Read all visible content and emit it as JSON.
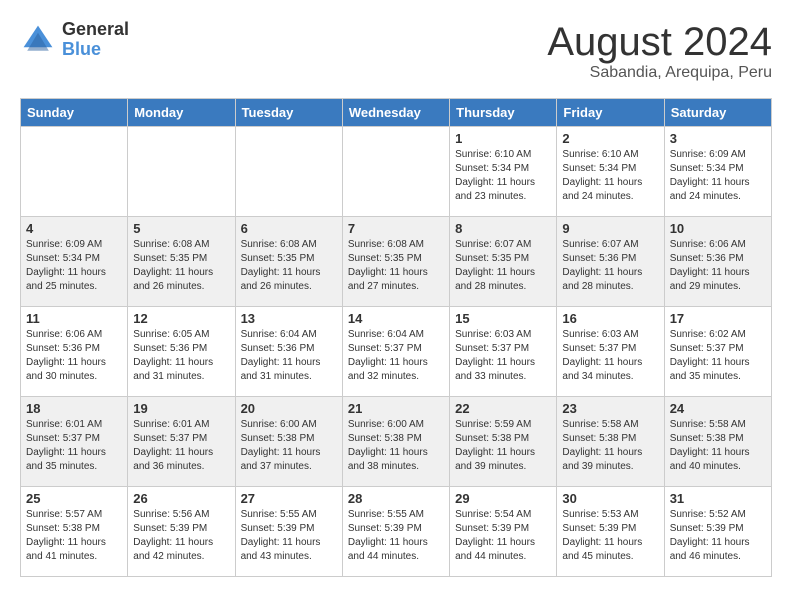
{
  "header": {
    "logo_general": "General",
    "logo_blue": "Blue",
    "title": "August 2024",
    "subtitle": "Sabandia, Arequipa, Peru"
  },
  "days_of_week": [
    "Sunday",
    "Monday",
    "Tuesday",
    "Wednesday",
    "Thursday",
    "Friday",
    "Saturday"
  ],
  "weeks": [
    [
      {
        "day": "",
        "info": ""
      },
      {
        "day": "",
        "info": ""
      },
      {
        "day": "",
        "info": ""
      },
      {
        "day": "",
        "info": ""
      },
      {
        "day": "1",
        "info": "Sunrise: 6:10 AM\nSunset: 5:34 PM\nDaylight: 11 hours\nand 23 minutes."
      },
      {
        "day": "2",
        "info": "Sunrise: 6:10 AM\nSunset: 5:34 PM\nDaylight: 11 hours\nand 24 minutes."
      },
      {
        "day": "3",
        "info": "Sunrise: 6:09 AM\nSunset: 5:34 PM\nDaylight: 11 hours\nand 24 minutes."
      }
    ],
    [
      {
        "day": "4",
        "info": "Sunrise: 6:09 AM\nSunset: 5:34 PM\nDaylight: 11 hours\nand 25 minutes."
      },
      {
        "day": "5",
        "info": "Sunrise: 6:08 AM\nSunset: 5:35 PM\nDaylight: 11 hours\nand 26 minutes."
      },
      {
        "day": "6",
        "info": "Sunrise: 6:08 AM\nSunset: 5:35 PM\nDaylight: 11 hours\nand 26 minutes."
      },
      {
        "day": "7",
        "info": "Sunrise: 6:08 AM\nSunset: 5:35 PM\nDaylight: 11 hours\nand 27 minutes."
      },
      {
        "day": "8",
        "info": "Sunrise: 6:07 AM\nSunset: 5:35 PM\nDaylight: 11 hours\nand 28 minutes."
      },
      {
        "day": "9",
        "info": "Sunrise: 6:07 AM\nSunset: 5:36 PM\nDaylight: 11 hours\nand 28 minutes."
      },
      {
        "day": "10",
        "info": "Sunrise: 6:06 AM\nSunset: 5:36 PM\nDaylight: 11 hours\nand 29 minutes."
      }
    ],
    [
      {
        "day": "11",
        "info": "Sunrise: 6:06 AM\nSunset: 5:36 PM\nDaylight: 11 hours\nand 30 minutes."
      },
      {
        "day": "12",
        "info": "Sunrise: 6:05 AM\nSunset: 5:36 PM\nDaylight: 11 hours\nand 31 minutes."
      },
      {
        "day": "13",
        "info": "Sunrise: 6:04 AM\nSunset: 5:36 PM\nDaylight: 11 hours\nand 31 minutes."
      },
      {
        "day": "14",
        "info": "Sunrise: 6:04 AM\nSunset: 5:37 PM\nDaylight: 11 hours\nand 32 minutes."
      },
      {
        "day": "15",
        "info": "Sunrise: 6:03 AM\nSunset: 5:37 PM\nDaylight: 11 hours\nand 33 minutes."
      },
      {
        "day": "16",
        "info": "Sunrise: 6:03 AM\nSunset: 5:37 PM\nDaylight: 11 hours\nand 34 minutes."
      },
      {
        "day": "17",
        "info": "Sunrise: 6:02 AM\nSunset: 5:37 PM\nDaylight: 11 hours\nand 35 minutes."
      }
    ],
    [
      {
        "day": "18",
        "info": "Sunrise: 6:01 AM\nSunset: 5:37 PM\nDaylight: 11 hours\nand 35 minutes."
      },
      {
        "day": "19",
        "info": "Sunrise: 6:01 AM\nSunset: 5:37 PM\nDaylight: 11 hours\nand 36 minutes."
      },
      {
        "day": "20",
        "info": "Sunrise: 6:00 AM\nSunset: 5:38 PM\nDaylight: 11 hours\nand 37 minutes."
      },
      {
        "day": "21",
        "info": "Sunrise: 6:00 AM\nSunset: 5:38 PM\nDaylight: 11 hours\nand 38 minutes."
      },
      {
        "day": "22",
        "info": "Sunrise: 5:59 AM\nSunset: 5:38 PM\nDaylight: 11 hours\nand 39 minutes."
      },
      {
        "day": "23",
        "info": "Sunrise: 5:58 AM\nSunset: 5:38 PM\nDaylight: 11 hours\nand 39 minutes."
      },
      {
        "day": "24",
        "info": "Sunrise: 5:58 AM\nSunset: 5:38 PM\nDaylight: 11 hours\nand 40 minutes."
      }
    ],
    [
      {
        "day": "25",
        "info": "Sunrise: 5:57 AM\nSunset: 5:38 PM\nDaylight: 11 hours\nand 41 minutes."
      },
      {
        "day": "26",
        "info": "Sunrise: 5:56 AM\nSunset: 5:39 PM\nDaylight: 11 hours\nand 42 minutes."
      },
      {
        "day": "27",
        "info": "Sunrise: 5:55 AM\nSunset: 5:39 PM\nDaylight: 11 hours\nand 43 minutes."
      },
      {
        "day": "28",
        "info": "Sunrise: 5:55 AM\nSunset: 5:39 PM\nDaylight: 11 hours\nand 44 minutes."
      },
      {
        "day": "29",
        "info": "Sunrise: 5:54 AM\nSunset: 5:39 PM\nDaylight: 11 hours\nand 44 minutes."
      },
      {
        "day": "30",
        "info": "Sunrise: 5:53 AM\nSunset: 5:39 PM\nDaylight: 11 hours\nand 45 minutes."
      },
      {
        "day": "31",
        "info": "Sunrise: 5:52 AM\nSunset: 5:39 PM\nDaylight: 11 hours\nand 46 minutes."
      }
    ]
  ]
}
